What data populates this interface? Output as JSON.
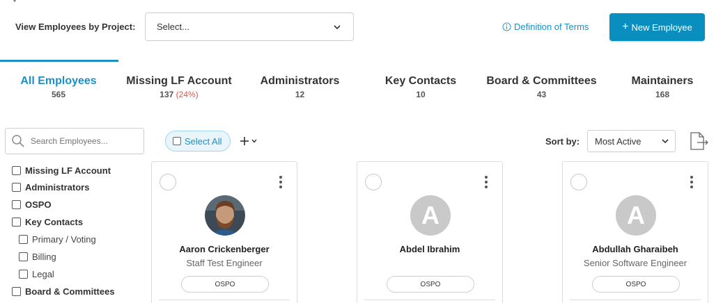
{
  "header": {
    "project_label": "View Employees by Project:",
    "project_select_value": "Select...",
    "definition_link": "Definition of Terms",
    "new_employee_label": "New Employee"
  },
  "tabs": [
    {
      "label": "All Employees",
      "count": "565",
      "pct": "",
      "active": true
    },
    {
      "label": "Missing LF Account",
      "count": "137",
      "pct": "(24%)",
      "active": false
    },
    {
      "label": "Administrators",
      "count": "12",
      "pct": "",
      "active": false
    },
    {
      "label": "Key Contacts",
      "count": "10",
      "pct": "",
      "active": false
    },
    {
      "label": "Board & Committees",
      "count": "43",
      "pct": "",
      "active": false
    },
    {
      "label": "Maintainers",
      "count": "168",
      "pct": "",
      "active": false
    }
  ],
  "toolbar": {
    "search_placeholder": "Search Employees...",
    "select_all_label": "Select All",
    "sort_label": "Sort by:",
    "sort_value": "Most Active"
  },
  "filters": [
    {
      "label": "Missing LF Account",
      "level": "main"
    },
    {
      "label": "Administrators",
      "level": "main"
    },
    {
      "label": "OSPO",
      "level": "main"
    },
    {
      "label": "Key Contacts",
      "level": "main"
    },
    {
      "label": "Primary / Voting",
      "level": "sub"
    },
    {
      "label": "Billing",
      "level": "sub"
    },
    {
      "label": "Legal",
      "level": "sub"
    },
    {
      "label": "Board & Committees",
      "level": "main"
    }
  ],
  "employees": [
    {
      "name": "Aaron Crickenberger",
      "title": "Staff Test Engineer",
      "badge": "OSPO",
      "initial": "",
      "has_photo": true
    },
    {
      "name": "Abdel Ibrahim",
      "title": "",
      "badge": "OSPO",
      "initial": "A",
      "has_photo": false
    },
    {
      "name": "Abdullah Gharaibeh",
      "title": "Senior Software Engineer",
      "badge": "OSPO",
      "initial": "A",
      "has_photo": false
    }
  ],
  "colors": {
    "accent": "#1d8fc3",
    "button": "#0a8ec0",
    "percent": "#e0524a",
    "avatar_placeholder": "#c9c9c9"
  }
}
